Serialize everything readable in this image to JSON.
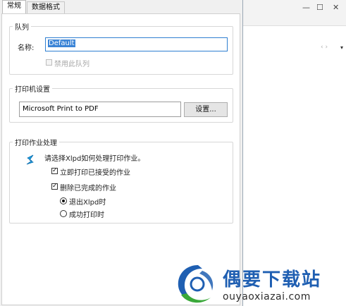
{
  "tabs": [
    {
      "label": "常规",
      "active": true
    },
    {
      "label": "数据格式",
      "active": false
    }
  ],
  "queue_group": {
    "title": "队列",
    "name_label": "名称:",
    "name_value": "Default",
    "disable_label": "禁用此队列",
    "disable_checked": false
  },
  "printer_group": {
    "title": "打印机设置",
    "printer_name": "Microsoft Print to PDF",
    "settings_button": "设置..."
  },
  "job_group": {
    "title": "打印作业处理",
    "prompt": "请选择Xlpd如何处理打印作业。",
    "option_print_label": "立即打印已接受的作业",
    "option_print_checked": true,
    "option_delete_label": "删除已完成的作业",
    "option_delete_checked": true,
    "radio_exit_label": "退出Xlpd时",
    "radio_exit_selected": true,
    "radio_success_label": "成功打印时",
    "radio_success_selected": false
  },
  "window_controls": {
    "minimize": "—",
    "maximize": "☐",
    "close": "✕"
  },
  "nav": {
    "arrows": "‹ ›",
    "dropdown": "▾"
  },
  "logo": {
    "text": "偶要下载站",
    "url": "ouyaoxiazai.com"
  },
  "colors": {
    "accent": "#2f7fd1",
    "selection": "#3b84d6",
    "logo_blue": "#1f5fb2",
    "logo_green": "#3aa83a"
  }
}
